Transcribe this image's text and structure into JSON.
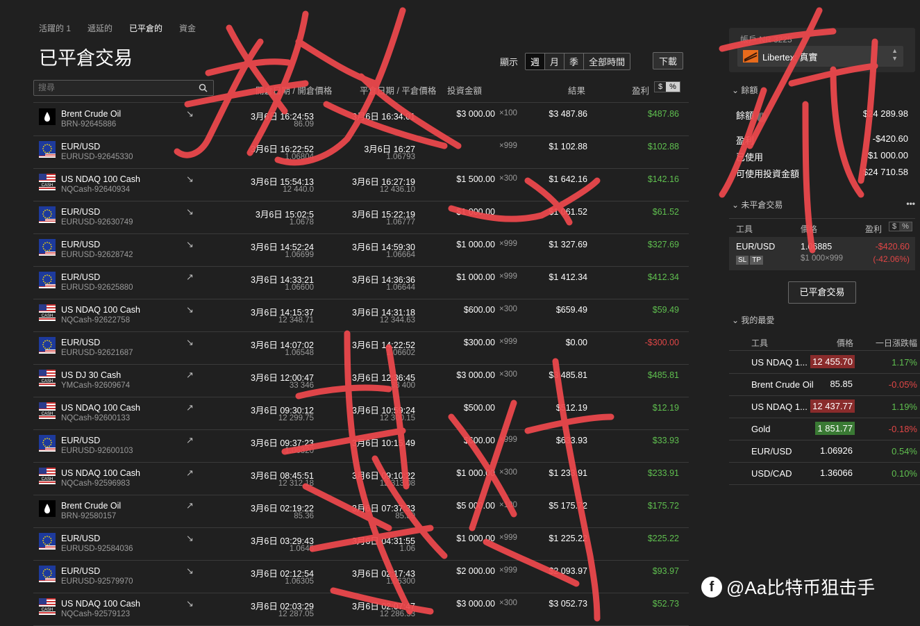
{
  "tabs": [
    "活躍的 1",
    "遞延的",
    "已平倉的",
    "資金"
  ],
  "page_title": "已平倉交易",
  "period": {
    "label": "顯示",
    "options": [
      "週",
      "月",
      "季",
      "全部時間"
    ],
    "download": "下載"
  },
  "search": {
    "placeholder": "搜尋"
  },
  "columns": {
    "open": "開倉日期 / 開倉價格",
    "close": "平倉日期 / 平倉價格",
    "invest": "投資金額",
    "result": "結果",
    "pl": "盈利",
    "dollar": "$",
    "percent": "%"
  },
  "trades": [
    {
      "name": "Brent Crude Oil",
      "code": "BRN-92645886",
      "flag": "oil",
      "dir": "↘",
      "open_time": "3月6日 16:24:53",
      "open_price": "86.09",
      "close_time": "3月6日 16:34:01",
      "close_price": "",
      "amount": "$3 000.00",
      "lev": "×100",
      "result": "$3 487.86",
      "pl": "$487.86",
      "pl_color": "green"
    },
    {
      "name": "EUR/USD",
      "code": "EURUSD-92645330",
      "flag": "eu",
      "dir": "",
      "open_time": "3月6日 16:22:52",
      "open_price": "1.06804",
      "close_time": "3月6日 16:27",
      "close_price": "1.06793",
      "amount": "",
      "lev": "×999",
      "result": "$1 102.88",
      "pl": "$102.88",
      "pl_color": "green"
    },
    {
      "name": "US NDAQ 100 Cash",
      "code": "NQCash-92640934",
      "flag": "us",
      "dir": "↘",
      "open_time": "3月6日 15:54:13",
      "open_price": "12 440.0",
      "close_time": "3月6日 16:27:19",
      "close_price": "12 436.10",
      "amount": "$1 500.00",
      "lev": "×300",
      "result": "$1 642.16",
      "pl": "$142.16",
      "pl_color": "green"
    },
    {
      "name": "EUR/USD",
      "code": "EURUSD-92630749",
      "flag": "eu",
      "dir": "↘",
      "open_time": "3月6日 15:02:5",
      "open_price": "1.0678",
      "close_time": "3月6日 15:22:19",
      "close_price": "1.06777",
      "amount": "$1 000.00",
      "lev": "",
      "result": "$1 061.52",
      "pl": "$61.52",
      "pl_color": "green"
    },
    {
      "name": "EUR/USD",
      "code": "EURUSD-92628742",
      "flag": "eu",
      "dir": "↘",
      "open_time": "3月6日 14:52:24",
      "open_price": "1.06699",
      "close_time": "3月6日 14:59:30",
      "close_price": "1.06664",
      "amount": "$1 000.00",
      "lev": "×999",
      "result": "$1 327.69",
      "pl": "$327.69",
      "pl_color": "green"
    },
    {
      "name": "EUR/USD",
      "code": "EURUSD-92625880",
      "flag": "eu",
      "dir": "↗",
      "open_time": "3月6日 14:33:21",
      "open_price": "1.06600",
      "close_time": "3月6日 14:36:36",
      "close_price": "1.06644",
      "amount": "$1 000.00",
      "lev": "×999",
      "result": "$1 412.34",
      "pl": "$412.34",
      "pl_color": "green"
    },
    {
      "name": "US NDAQ 100 Cash",
      "code": "NQCash-92622758",
      "flag": "us",
      "dir": "↘",
      "open_time": "3月6日 14:15:37",
      "open_price": "12 348.71",
      "close_time": "3月6日 14:31:18",
      "close_price": "12 344.63",
      "amount": "$600.00",
      "lev": "×300",
      "result": "$659.49",
      "pl": "$59.49",
      "pl_color": "green"
    },
    {
      "name": "EUR/USD",
      "code": "EURUSD-92621687",
      "flag": "eu",
      "dir": "↘",
      "open_time": "3月6日 14:07:02",
      "open_price": "1.06548",
      "close_time": "3月6日 14:22:52",
      "close_price": "1.06602",
      "amount": "$300.00",
      "lev": "×999",
      "result": "$0.00",
      "pl": "-$300.00",
      "pl_color": "red"
    },
    {
      "name": "US DJ 30 Cash",
      "code": "YMCash-92609674",
      "flag": "us",
      "dir": "↗",
      "open_time": "3月6日 12:00:47",
      "open_price": "33 346",
      "close_time": "3月6日 12:36:45",
      "close_price": "33 400",
      "amount": "$3 000.00",
      "lev": "×300",
      "result": "$3 485.81",
      "pl": "$485.81",
      "pl_color": "green"
    },
    {
      "name": "US NDAQ 100 Cash",
      "code": "NQCash-92600133",
      "flag": "us",
      "dir": "↗",
      "open_time": "3月6日 09:30:12",
      "open_price": "12 299.75",
      "close_time": "3月6日 10:59:24",
      "close_price": "12 300.15",
      "amount": "$500.00",
      "lev": "",
      "result": "$512.19",
      "pl": "$12.19",
      "pl_color": "green"
    },
    {
      "name": "EUR/USD",
      "code": "EURUSD-92600103",
      "flag": "eu",
      "dir": "↗",
      "open_time": "3月6日 09:37:23",
      "open_price": "1.06320",
      "close_time": "3月6日 10:15:49",
      "close_price": "",
      "amount": "$600.00",
      "lev": "×999",
      "result": "$633.93",
      "pl": "$33.93",
      "pl_color": "green"
    },
    {
      "name": "US NDAQ 100 Cash",
      "code": "NQCash-92596983",
      "flag": "us",
      "dir": "↗",
      "open_time": "3月6日 08:45:51",
      "open_price": "12 312.18",
      "close_time": "3月6日 09:10:22",
      "close_price": "12 313.08",
      "amount": "$1 000.00",
      "lev": "×300",
      "result": "$1 233.91",
      "pl": "$233.91",
      "pl_color": "green"
    },
    {
      "name": "Brent Crude Oil",
      "code": "BRN-92580157",
      "flag": "oil",
      "dir": "↗",
      "open_time": "3月6日 02:19:22",
      "open_price": "85.36",
      "close_time": "3月6日 07:37:33",
      "close_price": "85.39",
      "amount": "$5 000.00",
      "lev": "×100",
      "result": "$5 175.72",
      "pl": "$175.72",
      "pl_color": "green"
    },
    {
      "name": "EUR/USD",
      "code": "EURUSD-92584036",
      "flag": "eu",
      "dir": "↘",
      "open_time": "3月6日 03:29:43",
      "open_price": "1.0645",
      "close_time": "3月6日 04:31:55",
      "close_price": "1.06",
      "amount": "$1 000.00",
      "lev": "×999",
      "result": "$1 225.22",
      "pl": "$225.22",
      "pl_color": "green"
    },
    {
      "name": "EUR/USD",
      "code": "EURUSD-92579970",
      "flag": "eu",
      "dir": "↘",
      "open_time": "3月6日 02:12:54",
      "open_price": "1.06305",
      "close_time": "3月6日 02:17:43",
      "close_price": "1.06300",
      "amount": "$2 000.00",
      "lev": "×999",
      "result": "$2 093.97",
      "pl": "$93.97",
      "pl_color": "green"
    },
    {
      "name": "US NDAQ 100 Cash",
      "code": "NQCash-92579123",
      "flag": "us",
      "dir": "↘",
      "open_time": "3月6日 02:03:29",
      "open_price": "12 287.05",
      "close_time": "3月6日 02:07:47",
      "close_price": "12 286.33",
      "amount": "$3 000.00",
      "lev": "×300",
      "result": "$3 052.73",
      "pl": "$52.73",
      "pl_color": "green"
    }
  ],
  "account": {
    "label": "帳戶 NR 3225",
    "name": "Libertex: 真實",
    "section_balance": "餘額",
    "balance_label": "餘額",
    "balance": "$24 289.98",
    "pl_label": "盈利",
    "pl": "-$420.60",
    "used_label": "已使用",
    "used": "$1 000.00",
    "avail_label": "可使用投資金額",
    "avail": "$24 710.58"
  },
  "open_trades": {
    "section": "未平倉交易",
    "more": "•••",
    "col_instrument": "工具",
    "col_price": "價格",
    "col_pl": "盈利",
    "dollar": "$",
    "percent": "%",
    "row": {
      "name": "EUR/USD",
      "sl": "SL",
      "tp": "TP",
      "price": "1.06885",
      "amount": "$1 000×999",
      "pl": "-$420.60",
      "pl_pct": "(-42.06%)"
    },
    "closed_button": "已平倉交易"
  },
  "favorites": {
    "section": "我的最愛",
    "col_instrument": "工具",
    "col_price": "價格",
    "col_change": "一日漲跌幅",
    "items": [
      {
        "name": "US NDAQ 1...",
        "price": "12 455.70",
        "bg": "redbg",
        "change": "1.17%",
        "color": "green"
      },
      {
        "name": "Brent Crude Oil",
        "price": "85.85",
        "bg": "",
        "change": "-0.05%",
        "color": "red"
      },
      {
        "name": "US NDAQ 1...",
        "price": "12 437.77",
        "bg": "redbg",
        "change": "1.19%",
        "color": "green"
      },
      {
        "name": "Gold",
        "price": "1 851.77",
        "bg": "greenbg",
        "change": "-0.18%",
        "color": "red"
      },
      {
        "name": "EUR/USD",
        "price": "1.06926",
        "bg": "",
        "change": "0.54%",
        "color": "green"
      },
      {
        "name": "USD/CAD",
        "price": "1.36066",
        "bg": "",
        "change": "0.10%",
        "color": "green"
      }
    ]
  },
  "watermark": "@Aa比特币狙击手",
  "colors": {
    "green": "#5fbf4f",
    "red": "#e04646",
    "scribble": "#f0494d"
  }
}
